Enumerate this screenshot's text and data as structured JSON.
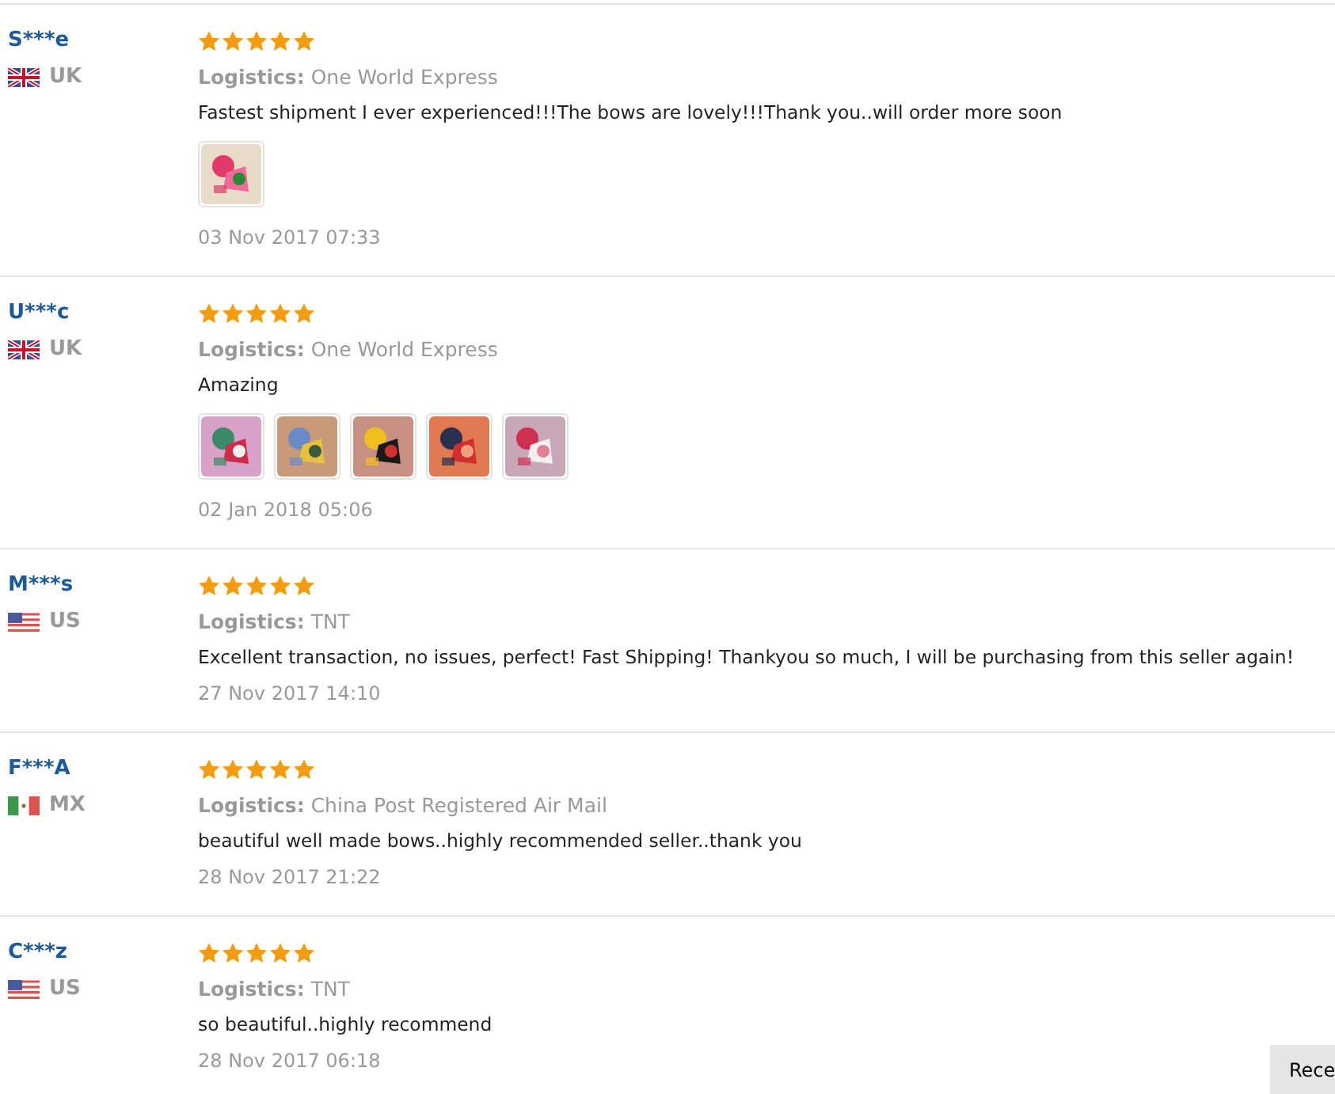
{
  "reviews": [
    {
      "name": "S***e",
      "country": "UK",
      "flag": {
        "kind": "uk"
      },
      "stars": 5,
      "logistics_label": "Logistics:",
      "logistics": "One World Express",
      "text": "Fastest shipment I ever experienced!!!The bows are lovely!!!Thank you..will order more soon",
      "photos": [
        {
          "kind": "picture"
        }
      ],
      "date": "03 Nov 2017 07:33"
    },
    {
      "name": "U***c",
      "country": "UK",
      "flag": {
        "kind": "uk"
      },
      "stars": 5,
      "logistics_label": "Logistics:",
      "logistics": "One World Express",
      "text": "Amazing",
      "photos": [
        {
          "kind": "picture"
        },
        {
          "kind": "picture"
        },
        {
          "kind": "picture"
        },
        {
          "kind": "picture"
        },
        {
          "kind": "picture"
        }
      ],
      "date": "02 Jan 2018 05:06"
    },
    {
      "name": "M***s",
      "country": "US",
      "flag": {
        "kind": "us"
      },
      "stars": 5,
      "logistics_label": "Logistics:",
      "logistics": "TNT",
      "text": "Excellent transaction, no issues, perfect! Fast Shipping! Thankyou so much, I will be purchasing from this seller again!",
      "date": "27 Nov 2017 14:10"
    },
    {
      "name": "F***A",
      "country": "MX",
      "flag": {
        "kind": "mx"
      },
      "stars": 5,
      "logistics_label": "Logistics:",
      "logistics": "China Post Registered Air Mail",
      "text": "beautiful well made bows..highly recommended seller..thank you",
      "date": "28 Nov 2017 21:22"
    },
    {
      "name": "C***z",
      "country": "US",
      "flag": {
        "kind": "us"
      },
      "stars": 5,
      "logistics_label": "Logistics:",
      "logistics": "TNT",
      "text": "so beautiful..highly recommend",
      "date": "28 Nov 2017 06:18"
    }
  ],
  "corner_button": "Rece"
}
